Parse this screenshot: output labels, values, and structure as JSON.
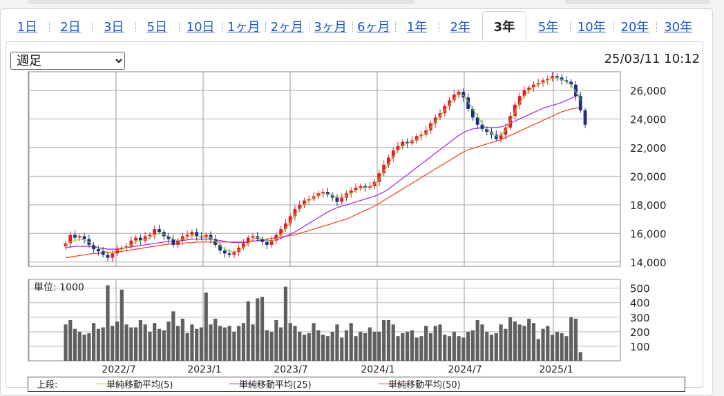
{
  "tabs": [
    {
      "label": "1日",
      "active": false
    },
    {
      "label": "2日",
      "active": false
    },
    {
      "label": "3日",
      "active": false
    },
    {
      "label": "5日",
      "active": false
    },
    {
      "label": "10日",
      "active": false
    },
    {
      "label": "1ヶ月",
      "active": false
    },
    {
      "label": "2ヶ月",
      "active": false
    },
    {
      "label": "3ヶ月",
      "active": false
    },
    {
      "label": "6ヶ月",
      "active": false
    },
    {
      "label": "1年",
      "active": false
    },
    {
      "label": "2年",
      "active": false
    },
    {
      "label": "3年",
      "active": true
    },
    {
      "label": "5年",
      "active": false
    },
    {
      "label": "10年",
      "active": false
    },
    {
      "label": "20年",
      "active": false
    },
    {
      "label": "30年",
      "active": false
    }
  ],
  "period_select": {
    "value": "週足",
    "options": [
      "週足"
    ]
  },
  "timestamp": "25/03/11 10:12",
  "colors": {
    "up": "#e8192c",
    "down": "#1a2e8c",
    "ma5": "#9acd32",
    "ma25": "#a020f0",
    "ma50": "#f04010",
    "volume": "#606060",
    "tab_link": "#1a55c9"
  },
  "chart_data": {
    "type": "candlestick",
    "price_axis": {
      "ticks": [
        "26,000",
        "24,000",
        "22,000",
        "20,000",
        "18,000",
        "16,000",
        "14,000"
      ],
      "range": [
        13700,
        27300
      ]
    },
    "volume_axis": {
      "unit_label": "単位: 1000",
      "ticks": [
        "500",
        "400",
        "300",
        "200",
        "100"
      ],
      "range": [
        0,
        560
      ]
    },
    "x_ticks": [
      "2022/7",
      "2023/1",
      "2023/7",
      "2024/1",
      "2024/7",
      "2025/1"
    ],
    "candles": [
      15300,
      15900,
      15700,
      15800,
      15600,
      15200,
      14900,
      14750,
      14500,
      14300,
      14600,
      14900,
      15000,
      15100,
      15500,
      15700,
      15500,
      15800,
      15900,
      16300,
      16100,
      15800,
      15600,
      15200,
      15500,
      15800,
      15900,
      16100,
      15800,
      15700,
      15900,
      15600,
      15200,
      14800,
      14600,
      14500,
      14700,
      15000,
      15300,
      15700,
      15800,
      15600,
      15400,
      15200,
      15500,
      15900,
      16300,
      16700,
      17200,
      17700,
      18000,
      18300,
      18400,
      18600,
      18800,
      18900,
      18700,
      18500,
      18200,
      18500,
      18800,
      19000,
      19200,
      19300,
      19200,
      19300,
      19600,
      20200,
      20800,
      21300,
      21800,
      22100,
      22400,
      22300,
      22500,
      22800,
      22900,
      23200,
      23700,
      24100,
      24400,
      24900,
      25300,
      25700,
      25900,
      25500,
      24700,
      24100,
      23600,
      23300,
      23100,
      22900,
      22600,
      22900,
      23400,
      24200,
      25000,
      25600,
      26000,
      26200,
      26400,
      26500,
      26700,
      26800,
      27000,
      26900,
      26700,
      26600,
      26400,
      25600,
      24600,
      23600
    ],
    "ma5": [
      15200,
      15400,
      15500,
      15600,
      15550,
      15400,
      15200,
      15000,
      14800,
      14700,
      14700,
      14800,
      14900,
      15000,
      15200,
      15400,
      15500,
      15600,
      15700,
      15900,
      16000,
      15950,
      15800,
      15600,
      15500,
      15600,
      15700,
      15850,
      15800,
      15750,
      15750,
      15700,
      15450,
      15150,
      14900,
      14750,
      14700,
      14800,
      15000,
      15300,
      15600,
      15700,
      15650,
      15500,
      15450,
      15600,
      15900,
      16300,
      16800,
      17300,
      17700,
      18050,
      18300,
      18500,
      18650,
      18750,
      18750,
      18650,
      18550,
      18550,
      18650,
      18800,
      19000,
      19150,
      19200,
      19300,
      19450,
      19800,
      20300,
      20850,
      21350,
      21800,
      22100,
      22300,
      22400,
      22600,
      22800,
      23000,
      23400,
      23800,
      24200,
      24600,
      25000,
      25400,
      25700,
      25650,
      25200,
      24700,
      24200,
      23700,
      23300,
      23000,
      22800,
      22850,
      23200,
      23800,
      24500,
      25100,
      25600,
      26000,
      26200,
      26400,
      26550,
      26700,
      26850,
      26850,
      26750,
      26600,
      26400,
      25900,
      25300
    ],
    "ma25": [
      15000,
      15050,
      15100,
      15100,
      15100,
      15100,
      15050,
      15000,
      14950,
      14900,
      14900,
      14900,
      14950,
      15000,
      15050,
      15100,
      15150,
      15200,
      15250,
      15300,
      15350,
      15400,
      15450,
      15450,
      15450,
      15500,
      15550,
      15600,
      15600,
      15600,
      15600,
      15600,
      15550,
      15500,
      15450,
      15400,
      15350,
      15350,
      15350,
      15400,
      15450,
      15500,
      15500,
      15500,
      15500,
      15550,
      15650,
      15800,
      15950,
      16100,
      16300,
      16500,
      16700,
      16900,
      17100,
      17300,
      17500,
      17650,
      17800,
      17900,
      18000,
      18100,
      18200,
      18300,
      18400,
      18500,
      18600,
      18750,
      18900,
      19100,
      19350,
      19600,
      19850,
      20100,
      20350,
      20600,
      20850,
      21100,
      21350,
      21600,
      21850,
      22100,
      22350,
      22600,
      22850,
      23050,
      23200,
      23300,
      23350,
      23400,
      23400,
      23400,
      23400,
      23450,
      23550,
      23700,
      23850,
      24000,
      24150,
      24300,
      24450,
      24600,
      24750,
      24850,
      24950,
      25050,
      25150,
      25300,
      25450,
      25600,
      25700
    ],
    "ma50": [
      14300,
      14350,
      14400,
      14450,
      14500,
      14550,
      14600,
      14600,
      14650,
      14650,
      14700,
      14700,
      14750,
      14800,
      14850,
      14900,
      14950,
      15000,
      15050,
      15100,
      15150,
      15200,
      15250,
      15250,
      15300,
      15300,
      15350,
      15350,
      15400,
      15400,
      15400,
      15400,
      15400,
      15400,
      15400,
      15400,
      15400,
      15400,
      15400,
      15400,
      15450,
      15500,
      15550,
      15600,
      15650,
      15700,
      15750,
      15800,
      15850,
      15900,
      16000,
      16100,
      16200,
      16300,
      16400,
      16500,
      16600,
      16700,
      16800,
      16900,
      17000,
      17150,
      17300,
      17450,
      17600,
      17750,
      17900,
      18100,
      18300,
      18500,
      18700,
      18900,
      19100,
      19300,
      19500,
      19700,
      19900,
      20100,
      20300,
      20500,
      20700,
      20900,
      21100,
      21300,
      21500,
      21700,
      21850,
      21950,
      22050,
      22150,
      22250,
      22350,
      22450,
      22550,
      22700,
      22850,
      23000,
      23150,
      23300,
      23450,
      23600,
      23750,
      23900,
      24050,
      24200,
      24350,
      24500,
      24600,
      24700,
      24750,
      24800
    ],
    "volumes": [
      250,
      280,
      220,
      200,
      180,
      190,
      260,
      220,
      230,
      520,
      240,
      270,
      490,
      250,
      230,
      230,
      280,
      250,
      200,
      260,
      220,
      210,
      270,
      340,
      240,
      290,
      190,
      250,
      220,
      230,
      470,
      250,
      290,
      240,
      230,
      240,
      200,
      240,
      260,
      410,
      250,
      430,
      440,
      210,
      200,
      280,
      230,
      510,
      260,
      240,
      200,
      180,
      190,
      260,
      210,
      180,
      170,
      200,
      250,
      160,
      210,
      260,
      170,
      200,
      190,
      230,
      200,
      200,
      280,
      280,
      250,
      170,
      190,
      200,
      210,
      160,
      170,
      240,
      190,
      240,
      250,
      180,
      170,
      200,
      170,
      160,
      200,
      210,
      280,
      250,
      200,
      180,
      190,
      250,
      220,
      300,
      270,
      250,
      240,
      290,
      260,
      150,
      220,
      240,
      180,
      200,
      190,
      170,
      300,
      290,
      60
    ]
  },
  "legend": {
    "prefix": "上段:",
    "items": [
      {
        "name": "単純移動平均(5)",
        "color": "#9acd32"
      },
      {
        "name": "単純移動平均(25)",
        "color": "#a020f0"
      },
      {
        "name": "単純移動平均(50)",
        "color": "#f04010"
      }
    ]
  }
}
